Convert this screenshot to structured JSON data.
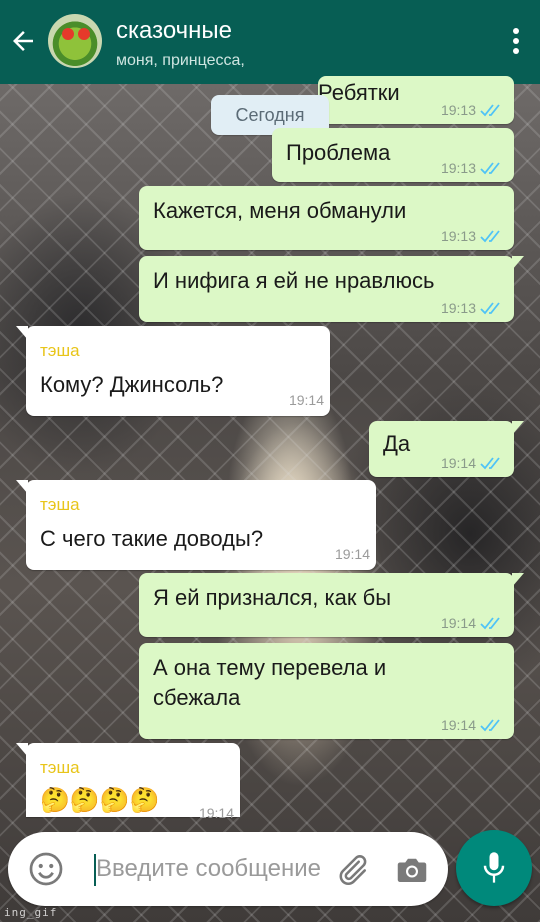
{
  "header": {
    "title": "сказочные",
    "subtitle": "моня, принцесса,"
  },
  "date_separator": "Сегодня",
  "messages": [
    {
      "dir": "out",
      "text": "Ребятки",
      "time": "19:13"
    },
    {
      "dir": "out",
      "text": "Проблема",
      "time": "19:13"
    },
    {
      "dir": "out",
      "text": "Кажется, меня обманули",
      "time": "19:13"
    },
    {
      "dir": "out",
      "text": "И нифига я ей не нравлюсь",
      "time": "19:13"
    },
    {
      "dir": "in",
      "sender": "тэша",
      "text": "Кому? Джинсоль?",
      "time": "19:14"
    },
    {
      "dir": "out",
      "text": "Да",
      "time": "19:14"
    },
    {
      "dir": "in",
      "sender": "тэша",
      "text": "С чего такие доводы?",
      "time": "19:14"
    },
    {
      "dir": "out",
      "text": "Я ей признался, как бы",
      "time": "19:14"
    },
    {
      "dir": "out",
      "text_line1": "А она тему перевела и",
      "text_line2": "сбежала",
      "time": "19:14"
    },
    {
      "dir": "in",
      "sender": "тэша",
      "text": "🤔🤔🤔🤔",
      "time": "19:14"
    }
  ],
  "composer": {
    "placeholder": "Введите сообщение"
  },
  "watermark": "ing_gif",
  "colors": {
    "header": "#075e54",
    "outgoing_bubble": "#dcf8c6",
    "incoming_bubble": "#ffffff",
    "read_ticks": "#4fc3f7",
    "sender_name": "#e8c51a",
    "mic_button": "#00897b"
  },
  "icons": [
    "back-arrow-icon",
    "group-avatar",
    "more-vert-icon",
    "emoji-icon",
    "attach-icon",
    "camera-icon",
    "mic-icon",
    "double-check-icon"
  ]
}
